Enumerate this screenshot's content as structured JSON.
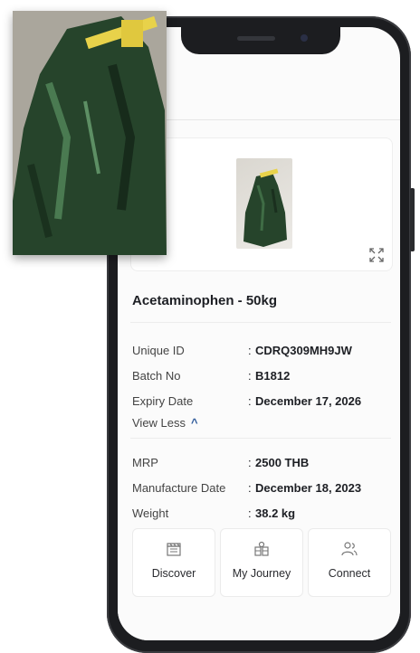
{
  "product": {
    "title": "Acetaminophen - 50kg"
  },
  "details": [
    {
      "label": "Unique ID",
      "value": "CDRQ309MH9JW"
    },
    {
      "label": "Batch No",
      "value": "B1812"
    },
    {
      "label": "Expiry Date",
      "value": "December 17, 2026"
    }
  ],
  "view_less": {
    "label": "View Less"
  },
  "extra_details": [
    {
      "label": "MRP",
      "value": "2500 THB"
    },
    {
      "label": "Manufacture Date",
      "value": "December 18, 2023"
    },
    {
      "label": "Weight",
      "value": "38.2 kg"
    }
  ],
  "actions": [
    {
      "label": "Discover",
      "icon": "clapperboard-icon"
    },
    {
      "label": "My Journey",
      "icon": "journey-map-icon"
    },
    {
      "label": "Connect",
      "icon": "users-icon"
    }
  ],
  "colors": {
    "accent": "#2e5a9a",
    "bag_green": "#25402a",
    "tie_yellow": "#e8d24a"
  }
}
